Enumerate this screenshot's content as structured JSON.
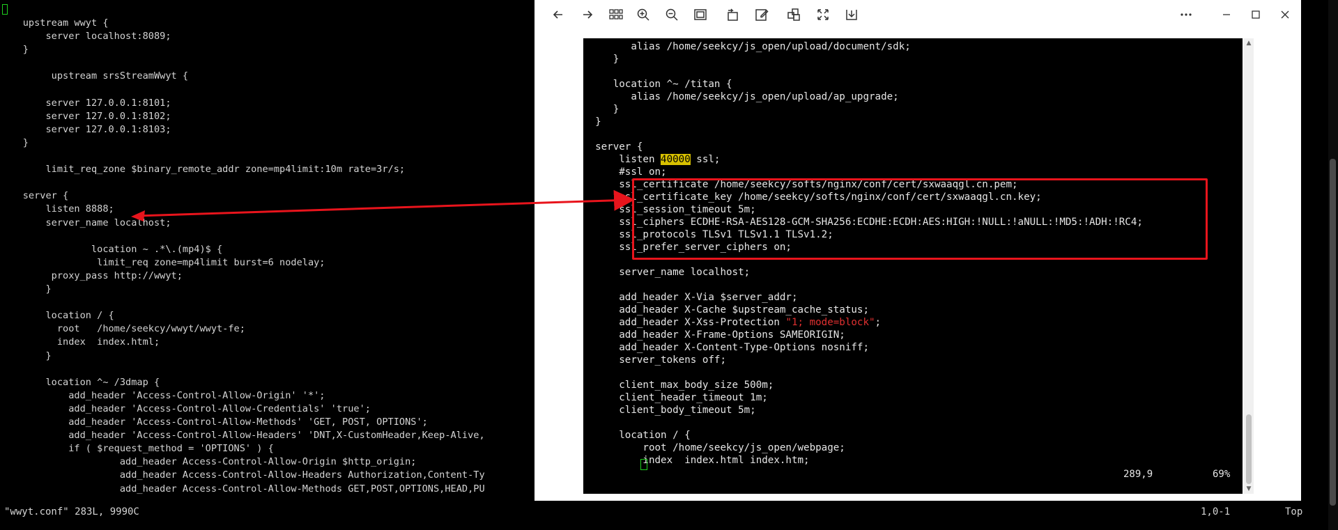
{
  "terminal": {
    "lines": [
      "    upstream wwyt {",
      "        server localhost:8089;",
      "    }",
      "",
      "         upstream srsStreamWwyt {",
      "",
      "        server 127.0.0.1:8101;",
      "        server 127.0.0.1:8102;",
      "        server 127.0.0.1:8103;",
      "    }",
      "",
      "        limit_req_zone $binary_remote_addr zone=mp4limit:10m rate=3r/s;",
      "",
      "    server {",
      "        listen 8888;",
      "        server_name localhost;",
      "",
      "                location ~ .*\\.(mp4)$ {",
      "                 limit_req zone=mp4limit burst=6 nodelay;",
      "         proxy_pass http://wwyt;",
      "        }",
      "",
      "        location / {",
      "          root   /home/seekcy/wwyt/wwyt-fe;",
      "          index  index.html;",
      "        }",
      "",
      "        location ^~ /3dmap {",
      "            add_header 'Access-Control-Allow-Origin' '*';",
      "            add_header 'Access-Control-Allow-Credentials' 'true';",
      "            add_header 'Access-Control-Allow-Methods' 'GET, POST, OPTIONS';",
      "            add_header 'Access-Control-Allow-Headers' 'DNT,X-CustomHeader,Keep-Alive,",
      "            if ( $request_method = 'OPTIONS' ) {",
      "                     add_header Access-Control-Allow-Origin $http_origin;",
      "                     add_header Access-Control-Allow-Headers Authorization,Content-Ty",
      "                     add_header Access-Control-Allow-Methods GET,POST,OPTIONS,HEAD,PU"
    ],
    "status_file": "\"wwyt.conf\" 283L, 9990C",
    "status_pos": "1,0-1",
    "status_scroll": "Top"
  },
  "viewer": {
    "shot_lines": {
      "l1": "        alias /home/seekcy/js_open/upload/document/sdk;",
      "l2": "     }",
      "l3": "",
      "l4": "     location ^~ /titan {",
      "l5": "        alias /home/seekcy/js_open/upload/ap_upgrade;",
      "l6": "     }",
      "l7": "  }",
      "l8": "",
      "l9": "  server {",
      "l10a": "      listen ",
      "l10b": "40000",
      "l10c": " ssl;",
      "l11": "      #ssl on;",
      "l12": "      ssl_certificate /home/seekcy/softs/nginx/conf/cert/sxwaaqgl.cn.pem;",
      "l13": "      ssl_certificate_key /home/seekcy/softs/nginx/conf/cert/sxwaaqgl.cn.key;",
      "l14": "      ssl_session_timeout 5m;",
      "l15": "      ssl_ciphers ECDHE-RSA-AES128-GCM-SHA256:ECDHE:ECDH:AES:HIGH:!NULL:!aNULL:!MD5:!ADH:!RC4;",
      "l16": "      ssl_protocols TLSv1 TLSv1.1 TLSv1.2;",
      "l17": "      ssl_prefer_server_ciphers on;",
      "l18": "",
      "l19": "      server_name localhost;",
      "l20": "",
      "l21": "      add_header X-Via $server_addr;",
      "l22": "      add_header X-Cache $upstream_cache_status;",
      "l23a": "      add_header X-Xss-Protection ",
      "l23b": "\"1; mode=block\"",
      "l23c": ";",
      "l24": "      add_header X-Frame-Options SAMEORIGIN;",
      "l25": "      add_header X-Content-Type-Options nosniff;",
      "l26": "      server_tokens off;",
      "l27": "",
      "l28": "      client_max_body_size 500m;",
      "l29": "      client_header_timeout 1m;",
      "l30": "      client_body_timeout 5m;",
      "l31": "",
      "l32": "      location / {",
      "l33": "          root /home/seekcy/js_open/webpage;",
      "l34": "          index  index.html index.htm;"
    },
    "status_pos": "289,9",
    "status_pct": "69%",
    "colors": {
      "highlight": "#d7c000",
      "comment": "#4d8cff",
      "string": "#e03030",
      "annotation_red": "#e8141c"
    },
    "toolbar_icons": [
      "back-arrow-icon",
      "forward-arrow-icon",
      "grid-icon",
      "zoom-in-icon",
      "zoom-out-icon",
      "fit-screen-icon",
      "rotate-icon",
      "edit-icon",
      "crop-icon",
      "fullscreen-icon",
      "download-icon",
      "more-icon",
      "minimize-icon",
      "maximize-icon",
      "close-icon"
    ]
  }
}
